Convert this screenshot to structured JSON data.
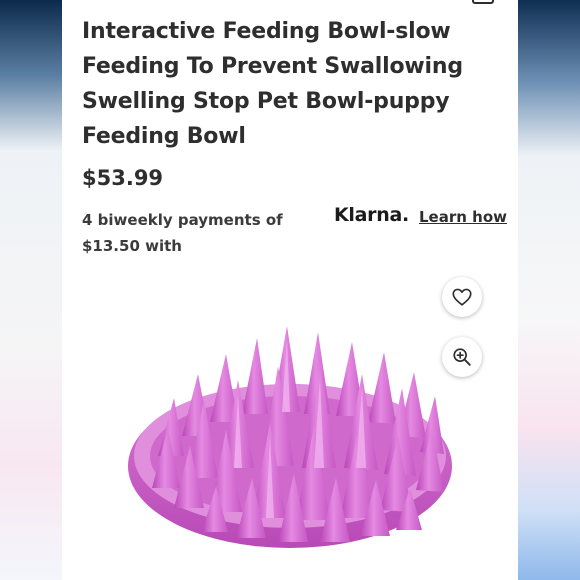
{
  "product": {
    "title": "Interactive Feeding Bowl-slow Feeding To Prevent Swallowing Swelling Stop Pet Bowl-puppy Feeding Bowl",
    "price": "$53.99"
  },
  "klarna": {
    "payment_text": "4 biweekly payments of $13.50 with",
    "brand": "Klarna.",
    "learn_link": "Learn how"
  },
  "icons": {
    "favorite": "heart-icon",
    "zoom": "zoom-in-icon",
    "cart": "cart-icon"
  },
  "colors": {
    "text": "#2e2e2e",
    "product_pink": "#d86fd6"
  }
}
